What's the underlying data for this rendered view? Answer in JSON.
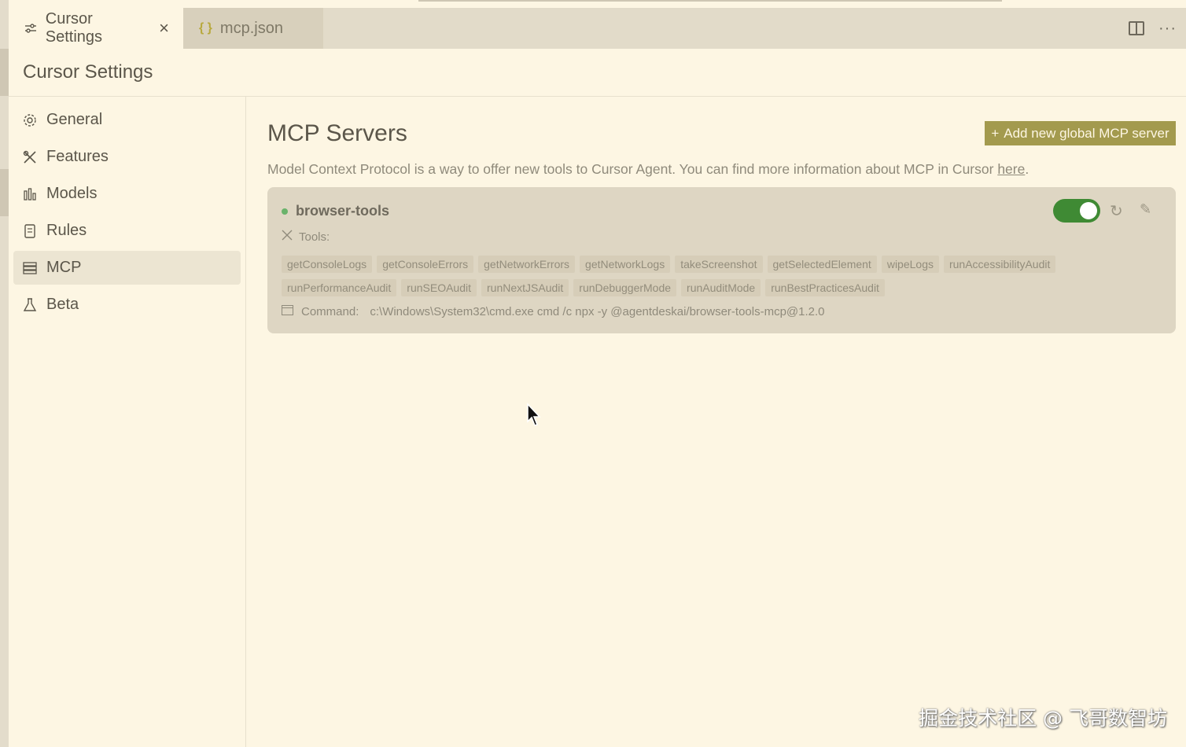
{
  "tabs": [
    {
      "label": "Cursor Settings",
      "icon": "sliders-icon",
      "active": true
    },
    {
      "label": "mcp.json",
      "icon": "json-braces-icon",
      "active": false
    }
  ],
  "tab_close": "×",
  "tab_json_icon": "{ }",
  "tabbar_more": "···",
  "header": {
    "title": "Cursor Settings"
  },
  "sidebar": {
    "items": [
      {
        "label": "General",
        "icon": "gear-icon"
      },
      {
        "label": "Features",
        "icon": "tools-icon"
      },
      {
        "label": "Models",
        "icon": "bar-chart-icon"
      },
      {
        "label": "Rules",
        "icon": "document-icon"
      },
      {
        "label": "MCP",
        "icon": "server-icon",
        "selected": true
      },
      {
        "label": "Beta",
        "icon": "flask-icon"
      }
    ]
  },
  "main": {
    "title": "MCP Servers",
    "add_button": "Add new global MCP server",
    "add_button_icon": "+",
    "description": "Model Context Protocol is a way to offer new tools to Cursor Agent. You can find more information about MCP in Cursor ",
    "description_link": "here",
    "description_end": "."
  },
  "server": {
    "name": "browser-tools",
    "status": "connected",
    "enabled": true,
    "tools_label": "Tools:",
    "tools": [
      "getConsoleLogs",
      "getConsoleErrors",
      "getNetworkErrors",
      "getNetworkLogs",
      "takeScreenshot",
      "getSelectedElement",
      "wipeLogs",
      "runAccessibilityAudit",
      "runPerformanceAudit",
      "runSEOAudit",
      "runNextJSAudit",
      "runDebuggerMode",
      "runAuditMode",
      "runBestPracticesAudit"
    ],
    "command_label": "Command:",
    "command_value": "c:\\Windows\\System32\\cmd.exe cmd /c npx -y @agentdeskai/browser-tools-mcp@1.2.0"
  },
  "icons": {
    "refresh": "↻",
    "edit": "✎"
  },
  "watermark": "掘金技术社区 @ 飞哥数智坊",
  "colors": {
    "accent": "#a39a4e",
    "toggle_on": "#3f8a34",
    "status_dot": "#6ab36b",
    "background": "#fdf6e3"
  }
}
